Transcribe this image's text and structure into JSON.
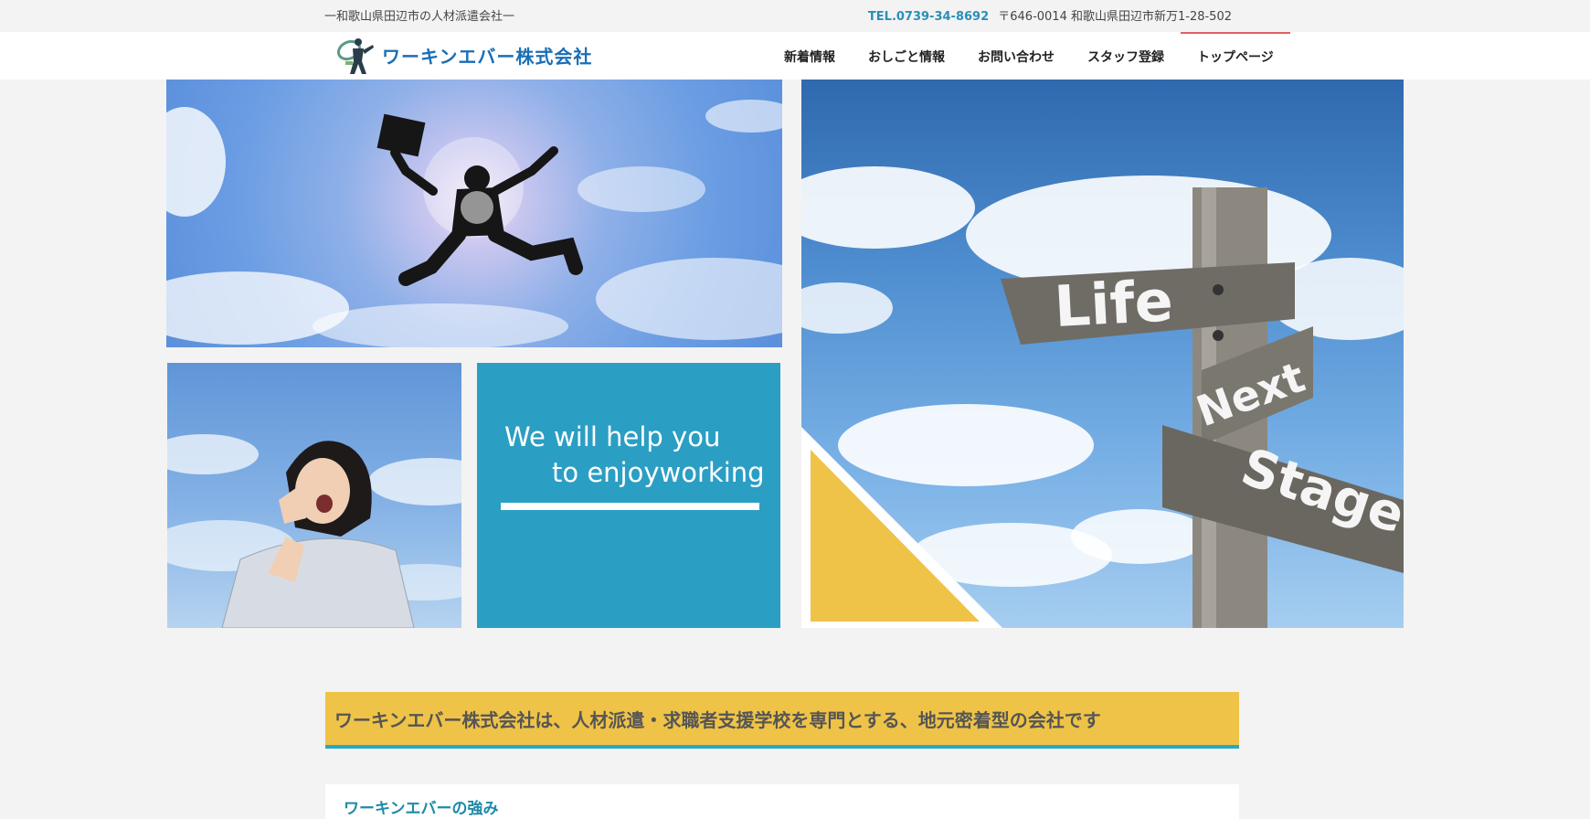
{
  "topbar": {
    "tagline": "一和歌山県田辺市の人材派遣会社一",
    "tel": "TEL.0739-34-8692",
    "address": "〒646-0014 和歌山県田辺市新万1-28-502"
  },
  "header": {
    "logo_text": "ワーキンエバー株式会社",
    "nav": [
      {
        "label": "新着情報"
      },
      {
        "label": "おしごと情報"
      },
      {
        "label": "お問い合わせ"
      },
      {
        "label": "スタッフ登録"
      },
      {
        "label": "トップページ",
        "active": true
      }
    ]
  },
  "hero": {
    "slogan_line1": "We will help you",
    "slogan_line2": "to enjoyworking",
    "signpost": [
      "Life",
      "Next",
      "Stage"
    ]
  },
  "intro": {
    "text": "ワーキンエバー株式会社は、人材派遣・求職者支援学校を専門とする、地元密着型の会社です"
  },
  "strengths": {
    "title": "ワーキンエバーの強み"
  },
  "colors": {
    "accent_blue": "#2b9ec3",
    "accent_yellow": "#efc347",
    "logo_blue": "#1a6fb5",
    "active_nav": "#e06060"
  }
}
